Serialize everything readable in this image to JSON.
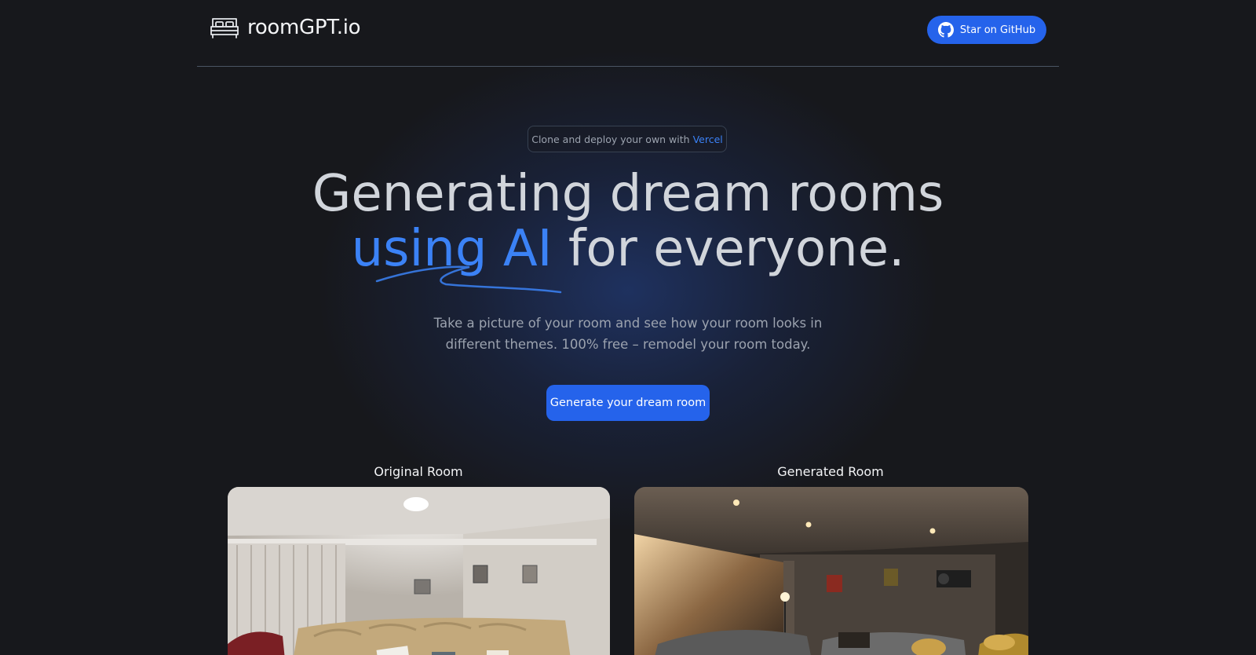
{
  "brand": {
    "name": "roomGPT.io",
    "logo_icon": "bed-icon"
  },
  "header": {
    "github_button_label": "Star on GitHub",
    "github_icon": "github-icon"
  },
  "hero": {
    "pill_prefix": "Clone and deploy your own with",
    "pill_link": "Vercel",
    "headline_line1": "Generating dream rooms",
    "headline_accent": "using AI",
    "headline_line2_rest": " for everyone.",
    "subtitle": "Take a picture of your room and see how your room looks in different themes. 100% free – remodel your room today.",
    "cta_label": "Generate your dream room"
  },
  "comparison": {
    "original_label": "Original Room",
    "generated_label": "Generated Room"
  },
  "colors": {
    "background": "#17181c",
    "accent": "#2563eb",
    "accent_text": "#3b82f6",
    "headline": "#d1d5db",
    "muted": "#9ca3af"
  }
}
